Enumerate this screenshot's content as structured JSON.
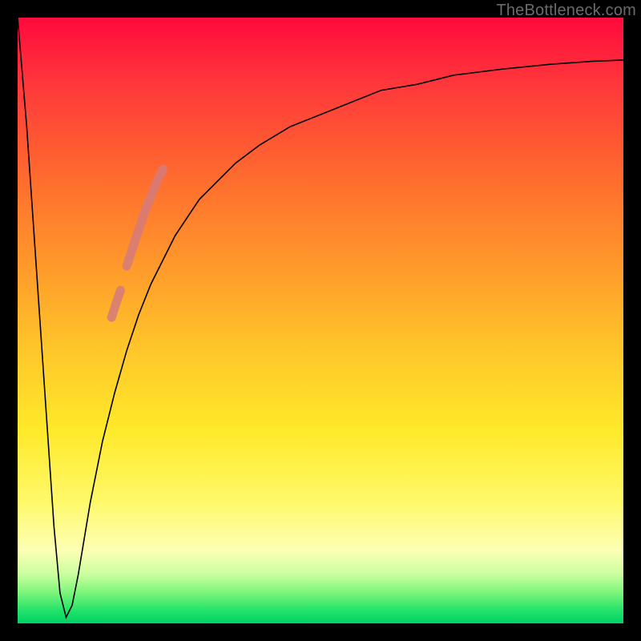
{
  "watermark": "TheBottleneck.com",
  "chart_data": {
    "type": "line",
    "title": "",
    "xlabel": "",
    "ylabel": "",
    "xlim": [
      0,
      100
    ],
    "ylim": [
      0,
      100
    ],
    "grid": false,
    "legend": false,
    "series": [
      {
        "name": "curve",
        "x": [
          0,
          1.5,
          3,
          4.5,
          6,
          7,
          8,
          9,
          10,
          11,
          12,
          14,
          16,
          18,
          20,
          22,
          24,
          26,
          28,
          30,
          33,
          36,
          40,
          45,
          50,
          55,
          60,
          66,
          72,
          80,
          88,
          95,
          100
        ],
        "y": [
          100,
          82,
          60,
          38,
          16,
          5,
          1,
          3,
          8,
          14,
          20,
          30,
          38,
          45,
          51,
          56,
          60,
          64,
          67,
          70,
          73,
          76,
          79,
          82,
          84,
          86,
          88,
          89,
          90.5,
          91.5,
          92.3,
          92.8,
          93
        ]
      },
      {
        "name": "highlight-segment-upper",
        "x": [
          18,
          19,
          20,
          21,
          22,
          23,
          24
        ],
        "y": [
          59,
          62,
          65,
          68,
          70.5,
          73,
          75
        ]
      },
      {
        "name": "highlight-segment-lower",
        "x": [
          15.5,
          16.3,
          17.0
        ],
        "y": [
          50.5,
          53,
          55
        ]
      }
    ],
    "colors": {
      "curve": "#000000",
      "highlight": "#d57b7b"
    }
  }
}
